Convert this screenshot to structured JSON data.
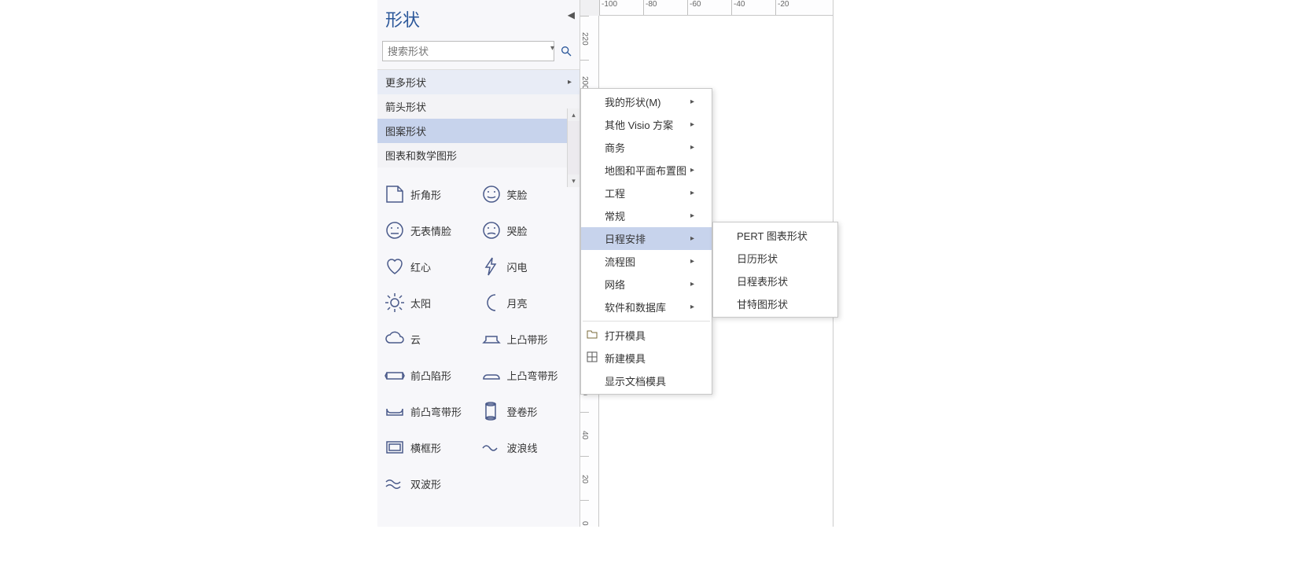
{
  "panel": {
    "title": "形状",
    "search_placeholder": "搜索形状",
    "categories": {
      "more": "更多形状",
      "arrows": "箭头形状",
      "patterns": "图案形状",
      "charts_math": "图表和数学图形"
    }
  },
  "shapes": [
    {
      "name": "折角形",
      "icon": "dogear"
    },
    {
      "name": "笑脸",
      "icon": "smile"
    },
    {
      "name": "无表情脸",
      "icon": "neutral"
    },
    {
      "name": "哭脸",
      "icon": "frown"
    },
    {
      "name": "红心",
      "icon": "heart"
    },
    {
      "name": "闪电",
      "icon": "bolt"
    },
    {
      "name": "太阳",
      "icon": "sun"
    },
    {
      "name": "月亮",
      "icon": "moon"
    },
    {
      "name": "云",
      "icon": "cloud"
    },
    {
      "name": "上凸带形",
      "icon": "ribbon-up"
    },
    {
      "name": "前凸陷形",
      "icon": "ribbon-front"
    },
    {
      "name": "上凸弯带形",
      "icon": "ribbon-curve-up"
    },
    {
      "name": "前凸弯带形",
      "icon": "ribbon-curve-front"
    },
    {
      "name": "登卷形",
      "icon": "scroll"
    },
    {
      "name": "横框形",
      "icon": "frame"
    },
    {
      "name": "波浪线",
      "icon": "wave"
    },
    {
      "name": "双波形",
      "icon": "double-wave"
    }
  ],
  "ruler_h": [
    "-100",
    "-80",
    "-60",
    "-40",
    "-20"
  ],
  "ruler_v": [
    "220",
    "200",
    "",
    "",
    "",
    "",
    "",
    "",
    "60",
    "40",
    "20",
    "0"
  ],
  "menu1": [
    {
      "label": "我的形状(M)",
      "sub": true
    },
    {
      "label": "其他 Visio 方案",
      "sub": true
    },
    {
      "label": "商务",
      "sub": true
    },
    {
      "label": "地图和平面布置图",
      "sub": true
    },
    {
      "label": "工程",
      "sub": true
    },
    {
      "label": "常规",
      "sub": true
    },
    {
      "label": "日程安排",
      "sub": true,
      "highlight": true
    },
    {
      "label": "流程图",
      "sub": true
    },
    {
      "label": "网络",
      "sub": true
    },
    {
      "label": "软件和数据库",
      "sub": true
    },
    {
      "sep": true
    },
    {
      "label": "打开模具",
      "icon": "open"
    },
    {
      "label": "新建模具",
      "icon": "new"
    },
    {
      "label": "显示文档模具"
    }
  ],
  "menu2": [
    {
      "label": "PERT 图表形状"
    },
    {
      "label": "日历形状"
    },
    {
      "label": "日程表形状"
    },
    {
      "label": "甘特图形状"
    }
  ]
}
